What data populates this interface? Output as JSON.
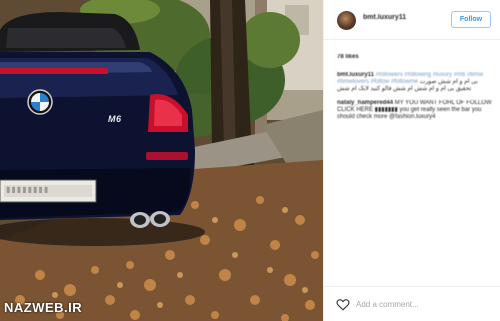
{
  "photo": {
    "watermark": "NAZWEB.IR",
    "car_badge_text": "M6",
    "plate_text": "▮▮▮▮▮▮▮▮"
  },
  "post": {
    "username": "bmt.luxury11",
    "follow_label": "Follow",
    "likes_text": "78 likes",
    "comments": [
      {
        "user": "bmt.luxury11",
        "tags": "#followers #following #luxury #m6 #bmw #bmwlovers #follow #followme",
        "text": "بی ام و ام شش صورت تحقیق بی ام و ام شش ام شش فالو کنید لایک ام شش"
      },
      {
        "user": "nataly_hampered44",
        "text": "MY YOU WANT FOHL OF FOLLOW CLICK HERE ▮▮▮▮▮▮▮ you get really seen the bar you should check more @fashion.luxury4"
      }
    ],
    "comment_placeholder": "Add a comment..."
  },
  "colors": {
    "follow_blue": "#3897f0",
    "follow_border": "#9fc6ec",
    "text_dark": "#262626",
    "placeholder_gray": "#a8a8a8",
    "divider": "#efefef",
    "car_body": "#0c1230"
  },
  "icons": {
    "like": "heart-outline-icon",
    "car_logo": "bmw-roundel-icon"
  }
}
